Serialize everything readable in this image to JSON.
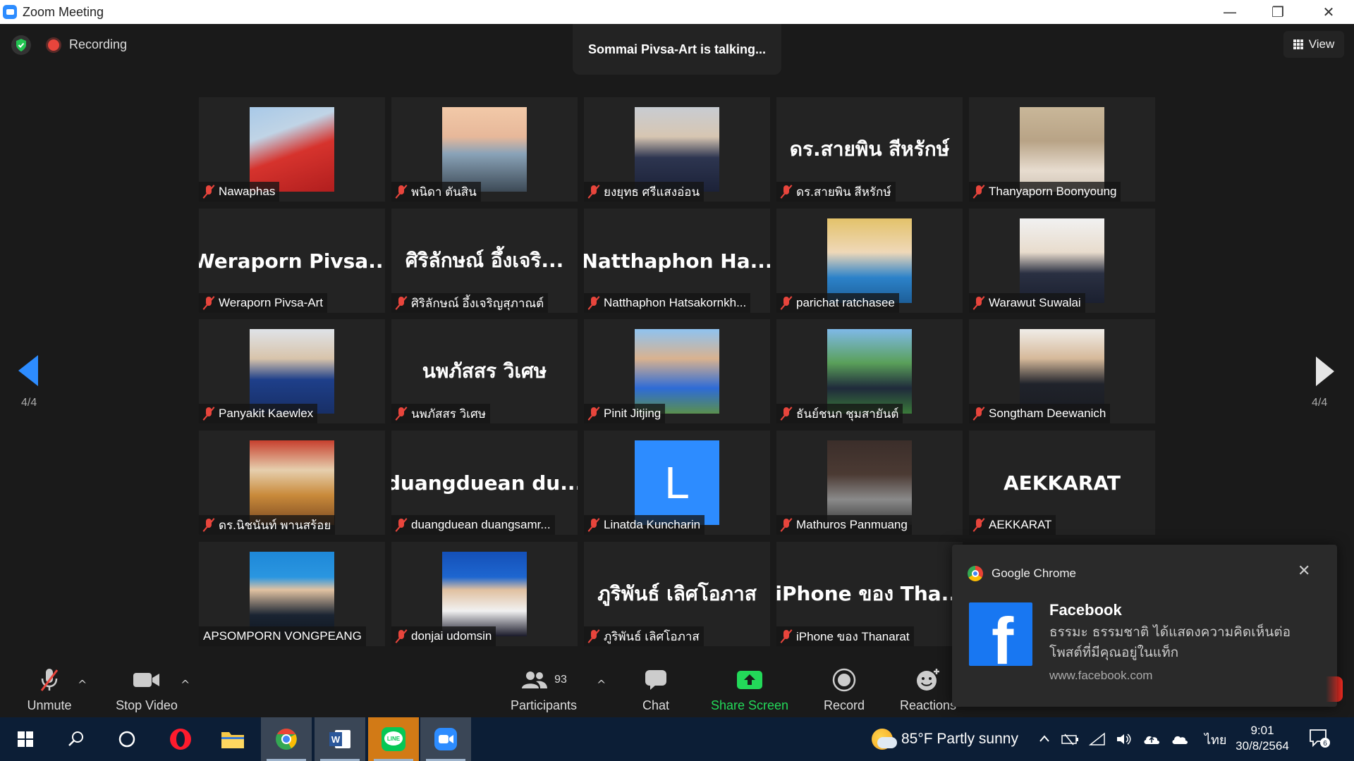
{
  "window": {
    "title": "Zoom Meeting",
    "minimize": "—",
    "restore": "❐",
    "close": "✕"
  },
  "meeting": {
    "recording_label": "Recording",
    "talking": "Sommai Pivsa-Art is talking...",
    "view_label": "View",
    "page_left": "4/4",
    "page_right": "4/4"
  },
  "tiles": [
    {
      "name": "Nawaphas",
      "muted": true,
      "photo": "woman-red-mask"
    },
    {
      "name": "พนิดา ตันสิน",
      "muted": true,
      "photo": "woman-beach"
    },
    {
      "name": "ยงยุทธ ศรีแสงอ่อน",
      "muted": true,
      "photo": "man-suit"
    },
    {
      "name": "ดร.สายพิน สีหรักษ์",
      "muted": true,
      "big": "ดร.สายพิน สีหรักษ์"
    },
    {
      "name": "Thanyaporn Boonyoung",
      "muted": true,
      "photo": "woman-laughing"
    },
    {
      "name": "Weraporn Pivsa-Art",
      "muted": true,
      "big": "Weraporn Pivsa..."
    },
    {
      "name": "ศิริลักษณ์ อึ้งเจริญสุภาณต์",
      "muted": true,
      "big": "ศิริลักษณ์ อึ้งเจริ..."
    },
    {
      "name": "Natthaphon Hatsakornkh...",
      "muted": true,
      "big": "Natthaphon Ha..."
    },
    {
      "name": "parichat ratchasee",
      "muted": true,
      "photo": "woman-selfie"
    },
    {
      "name": "Warawut Suwalai",
      "muted": true,
      "photo": "man-suit-light"
    },
    {
      "name": "Panyakit Kaewlex",
      "muted": true,
      "photo": "man-blue-shirt"
    },
    {
      "name": "นพภัสสร วิเศษ",
      "muted": true,
      "big": "นพภัสสร วิเศษ"
    },
    {
      "name": "Pinit Jitjing",
      "muted": true,
      "photo": "man-sunglasses"
    },
    {
      "name": "ธันย์ชนก ชุมสายันต์",
      "muted": true,
      "photo": "woman-field"
    },
    {
      "name": "Songtham Deewanich",
      "muted": true,
      "photo": "man-speaking"
    },
    {
      "name": "ดร.นิชนันท์ พานสร้อย",
      "muted": true,
      "photo": "woman-temple"
    },
    {
      "name": "duangduean duangsamr...",
      "muted": true,
      "big": "duangduean du..."
    },
    {
      "name": "Linatda Kuncharin",
      "muted": true,
      "letter": "L"
    },
    {
      "name": "Mathuros Panmuang",
      "muted": true,
      "photo": "woman-brick"
    },
    {
      "name": "AEKKARAT",
      "muted": true,
      "big": "AEKKARAT"
    },
    {
      "name": "APSOMPORN VONGPEANG",
      "muted": false,
      "photo": "man-id-photo"
    },
    {
      "name": "donjai udomsin",
      "muted": true,
      "photo": "man-portrait-blue"
    },
    {
      "name": "ภูริพันธ์ เลิศโอภาส",
      "muted": true,
      "big": "ภูริพันธ์ เลิศโอภาส"
    },
    {
      "name": "iPhone ของ Thanarat",
      "muted": true,
      "big": "iPhone ของ Tha..."
    }
  ],
  "toolbar": {
    "unmute": "Unmute",
    "stop_video": "Stop Video",
    "participants": "Participants",
    "participants_count": "93",
    "chat": "Chat",
    "share_screen": "Share Screen",
    "record": "Record",
    "reactions": "Reactions",
    "caret": "^"
  },
  "notification": {
    "app": "Google Chrome",
    "title": "Facebook",
    "message": "ธรรมะ ธรรมชาติ ได้แสดงความคิดเห็นต่อโพสต์ที่มีคุณอยู่ในแท็ก",
    "source": "www.facebook.com",
    "close": "✕",
    "logo_letter": "f"
  },
  "taskbar": {
    "weather": "85°F  Partly sunny",
    "ime": "ไทย",
    "time": "9:01",
    "date": "30/8/2564",
    "notif_count": "6",
    "word_letter": "W",
    "line_label": "LINE"
  },
  "colors": {
    "accent": "#2d8cff",
    "muted_red": "#e8453c",
    "share_green": "#23d959",
    "tile_bg": "#232323"
  }
}
